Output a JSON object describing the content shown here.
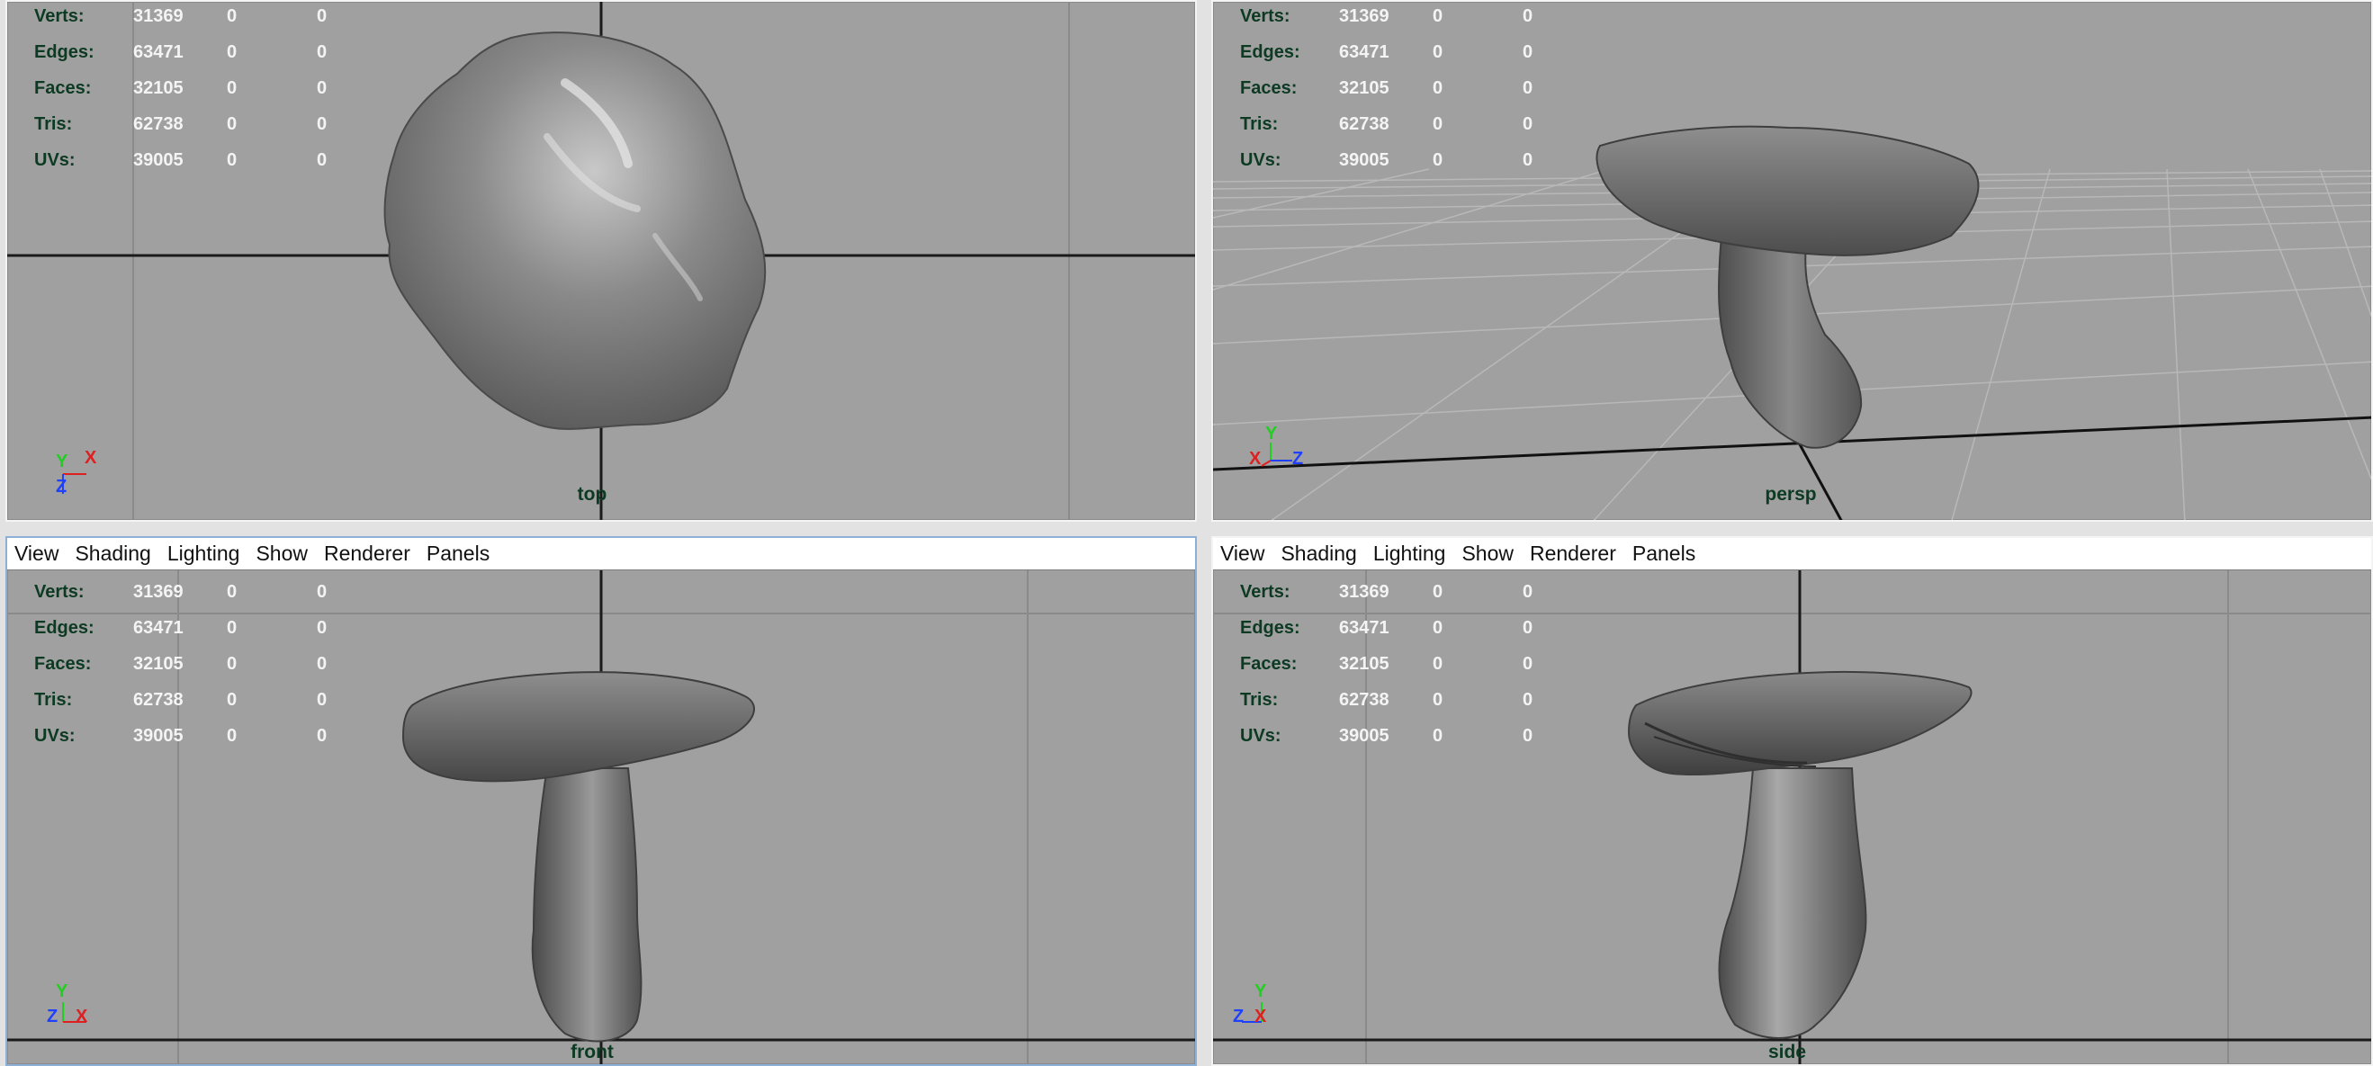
{
  "viewports": [
    {
      "camera": "top",
      "stats": {
        "verts": [
          "31369",
          "0",
          "0"
        ],
        "edges": [
          "63471",
          "0",
          "0"
        ],
        "faces": [
          "32105",
          "0",
          "0"
        ],
        "tris": [
          "62738",
          "0",
          "0"
        ],
        "uvs": [
          "39005",
          "0",
          "0"
        ]
      }
    },
    {
      "camera": "persp",
      "stats": {
        "verts": [
          "31369",
          "0",
          "0"
        ],
        "edges": [
          "63471",
          "0",
          "0"
        ],
        "faces": [
          "32105",
          "0",
          "0"
        ],
        "tris": [
          "62738",
          "0",
          "0"
        ],
        "uvs": [
          "39005",
          "0",
          "0"
        ]
      }
    },
    {
      "camera": "front",
      "menu": [
        "View",
        "Shading",
        "Lighting",
        "Show",
        "Renderer",
        "Panels"
      ],
      "stats": {
        "verts": [
          "31369",
          "0",
          "0"
        ],
        "edges": [
          "63471",
          "0",
          "0"
        ],
        "faces": [
          "32105",
          "0",
          "0"
        ],
        "tris": [
          "62738",
          "0",
          "0"
        ],
        "uvs": [
          "39005",
          "0",
          "0"
        ]
      }
    },
    {
      "camera": "side",
      "menu": [
        "View",
        "Shading",
        "Lighting",
        "Show",
        "Renderer",
        "Panels"
      ],
      "stats": {
        "verts": [
          "31369",
          "0",
          "0"
        ],
        "edges": [
          "63471",
          "0",
          "0"
        ],
        "faces": [
          "32105",
          "0",
          "0"
        ],
        "tris": [
          "62738",
          "0",
          "0"
        ],
        "uvs": [
          "39005",
          "0",
          "0"
        ]
      }
    }
  ],
  "hud_labels": {
    "verts": "Verts:",
    "edges": "Edges:",
    "faces": "Faces:",
    "tris": "Tris:",
    "uvs": "UVs:"
  },
  "axes": {
    "top": {
      "up": "Y",
      "right": "X",
      "down": "Z"
    },
    "persp": {
      "up": "Y",
      "left": "X",
      "right": "Z"
    },
    "front": {
      "up": "Y",
      "left": "Z",
      "right": "X"
    },
    "side": {
      "up": "Y",
      "left": "Z",
      "right": "X"
    }
  },
  "colors": {
    "viewport_bg": "#a0a0a0",
    "grid": "#888888",
    "hud_label": "#0c3a22",
    "hud_value": "#f4f4f4",
    "axis_x": "#e02020",
    "axis_y": "#20d020",
    "axis_z": "#2040ff",
    "mesh": "#6e6e6e"
  }
}
